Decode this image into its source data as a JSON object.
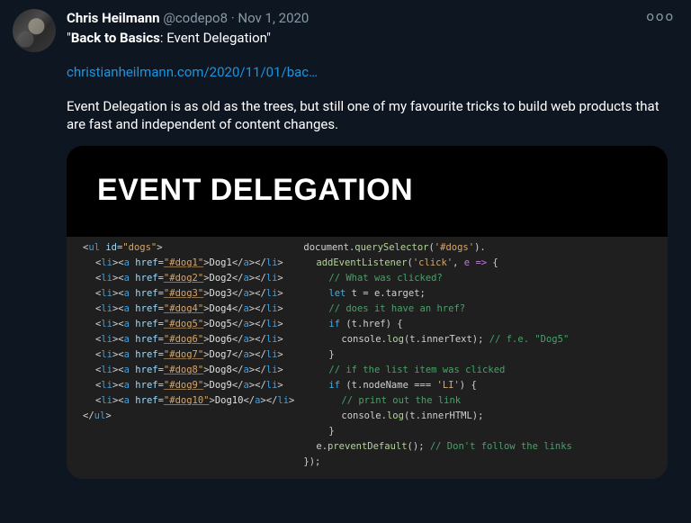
{
  "author": {
    "display_name": "Chris Heilmann",
    "handle": "@codepo8",
    "separator": " · ",
    "date": "Nov 1, 2020"
  },
  "more_label": "ooo",
  "title": {
    "quote_open": "\"",
    "bold": "Back to Basics",
    "rest": ": Event Delegation\""
  },
  "link_text": "christianheilmann.com/2020/11/01/bac…",
  "tweet_body": "Event Delegation is as old as the trees, but still one of my favourite tricks to build web products that are fast and independent of content changes.",
  "card": {
    "hero_text": "EVENT DELEGATION",
    "html_block": {
      "open": "<ul id=\"dogs\">",
      "items": [
        {
          "href": "#dog1",
          "text": "Dog1"
        },
        {
          "href": "#dog2",
          "text": "Dog2"
        },
        {
          "href": "#dog3",
          "text": "Dog3"
        },
        {
          "href": "#dog4",
          "text": "Dog4"
        },
        {
          "href": "#dog5",
          "text": "Dog5"
        },
        {
          "href": "#dog6",
          "text": "Dog6"
        },
        {
          "href": "#dog7",
          "text": "Dog7"
        },
        {
          "href": "#dog8",
          "text": "Dog8"
        },
        {
          "href": "#dog9",
          "text": "Dog9"
        },
        {
          "href": "#dog10",
          "text": "Dog10"
        }
      ],
      "close": "</ul>"
    },
    "js_block": {
      "l1": "document.querySelector('#dogs').",
      "l2": "addEventListener('click', e => {",
      "l3": "// What was clicked?",
      "l4_kw": "let",
      "l4_rest": " t = e.target;",
      "l5": "// does it have an href?",
      "l6_kw": "if",
      "l6_rest": " (t.href) {",
      "l7a": "console.log(t.innerText);",
      "l7b": " // f.e. \"Dog5\"",
      "l8": "}",
      "l9": "// if the list item was clicked",
      "l10_kw": "if",
      "l10_rest": " (t.nodeName === 'LI') {",
      "l11": "// print out the link",
      "l12": "console.log(t.innerHTML);",
      "l13": "}",
      "l14a": "e.preventDefault();",
      "l14b": " // Don't follow the links",
      "l15": "});"
    }
  }
}
